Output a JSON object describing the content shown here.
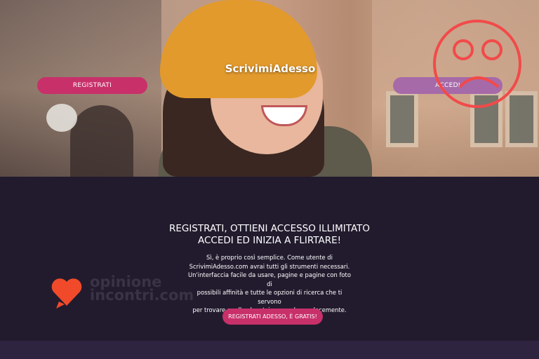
{
  "brand": {
    "name": "ScrivimiAdesso"
  },
  "hero": {
    "register_label": "REGISTRATI",
    "login_label": "ACCEDI"
  },
  "main": {
    "headline_line1": "REGISTRATI, OTTIENI ACCESSO ILLIMITATO",
    "headline_line2": "ACCEDI ED INIZIA A FLIRTARE!",
    "body_lines": [
      "Sì, è proprio così semplice. Come utente di",
      "ScrivimiAdesso.com avrai tutti gli strumenti necessari.",
      "Un'interfaccia facile da usare, pagine e pagine con foto di",
      "possibili affinità e tutte le opzioni di ricerca che ti servono",
      "per trovare quello che stai cercando... velocemente."
    ],
    "cta_label": "REGISTRATI ADESSO, È GRATIS!"
  },
  "watermark": {
    "line1": "opinione",
    "line2": "incontri.com"
  },
  "colors": {
    "accent": "#c8306a",
    "login": "#a66aa9",
    "background": "#221b2e",
    "sad_face": "#f24a4a",
    "watermark_heart": "#f04a2a"
  },
  "icons": {
    "rating": "sad-face-icon",
    "watermark": "heart-chat-icon"
  }
}
